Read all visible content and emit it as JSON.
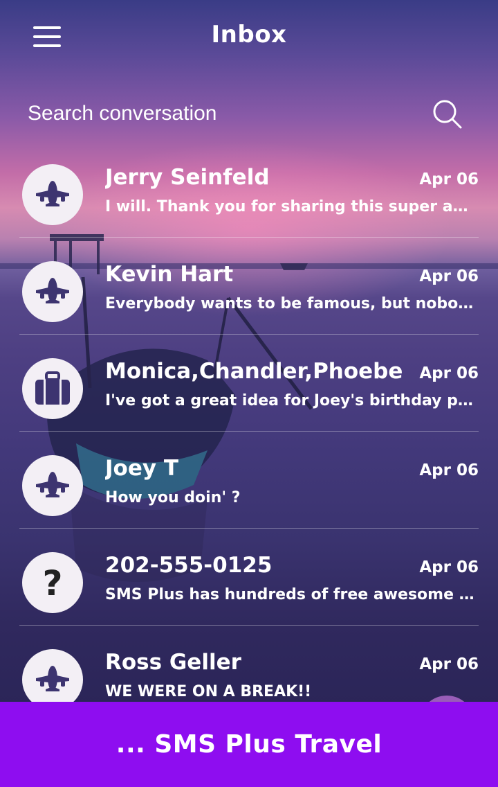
{
  "header": {
    "title": "Inbox",
    "menu_icon": "hamburger-menu-icon"
  },
  "search": {
    "placeholder": "Search conversation",
    "icon": "search-icon"
  },
  "conversations": [
    {
      "avatar_icon": "airplane-icon",
      "name": "Jerry Seinfeld",
      "snippet": "I will. Thank you for sharing this super app!",
      "date": "Apr 06"
    },
    {
      "avatar_icon": "airplane-icon",
      "name": "Kevin Hart",
      "snippet": "Everybody wants to be famous, but nobody wants to w...",
      "date": "Apr 06"
    },
    {
      "avatar_icon": "suitcase-icon",
      "name": "Monica,Chandler,Phoebe",
      "snippet": "I've got a great idea for Joey's birthday present featur...",
      "date": "Apr 06"
    },
    {
      "avatar_icon": "airplane-icon",
      "name": "Joey T",
      "snippet": "How you doin' ?",
      "date": "Apr 06"
    },
    {
      "avatar_icon": "question-mark-icon",
      "name": "202-555-0125",
      "snippet": "SMS Plus has hundreds of free awesome themes adde...",
      "date": "Apr 06"
    },
    {
      "avatar_icon": "airplane-icon",
      "name": "Ross Geller",
      "snippet": "WE WERE ON  A BREAK!!",
      "date": "Apr 06"
    }
  ],
  "banner": {
    "text": "... SMS Plus Travel"
  },
  "colors": {
    "banner": "#8e0df0",
    "avatar_bg": "#f3eff5",
    "avatar_icon": "#3d3470"
  }
}
